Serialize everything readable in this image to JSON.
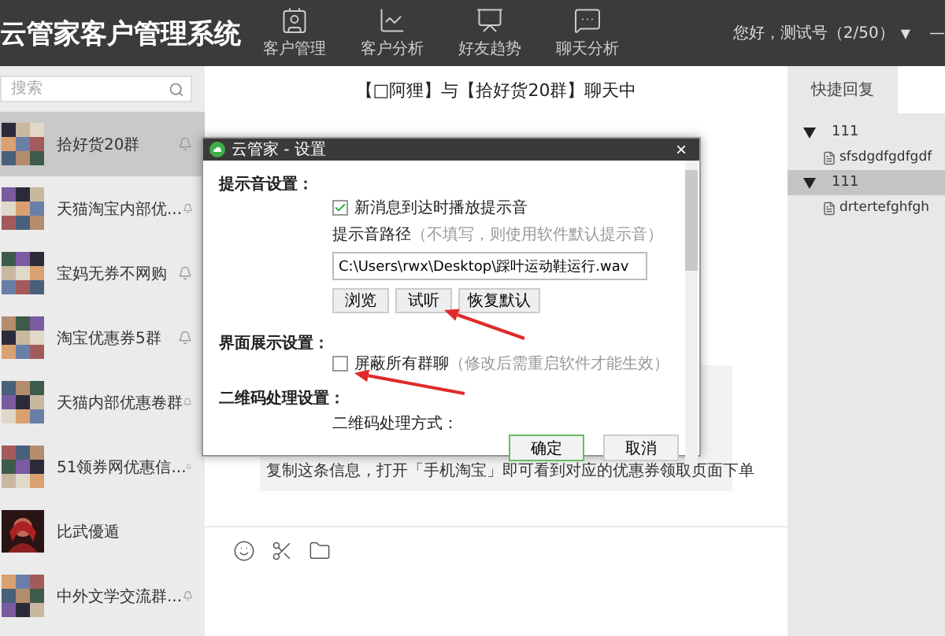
{
  "app": {
    "title": "云管家客户管理系统",
    "user": "您好，测试号（2/50）",
    "user_caret": "▼",
    "minimize": "—"
  },
  "nav": [
    {
      "label": "客户管理",
      "kind": "card"
    },
    {
      "label": "客户分析",
      "kind": "chart"
    },
    {
      "label": "好友趋势",
      "kind": "board"
    },
    {
      "label": "聊天分析",
      "kind": "chat"
    }
  ],
  "sidebar": {
    "search": {
      "placeholder": "搜索"
    },
    "items": [
      {
        "name": "拾好货20群",
        "selected": true,
        "bell": true,
        "kind": "mosaic"
      },
      {
        "name": "天猫淘宝内部优...",
        "selected": false,
        "bell": true,
        "kind": "mosaic"
      },
      {
        "name": "宝妈无券不网购",
        "selected": false,
        "bell": true,
        "kind": "mosaic"
      },
      {
        "name": "淘宝优惠券5群",
        "selected": false,
        "bell": true,
        "kind": "mosaic"
      },
      {
        "name": "天猫内部优惠卷群",
        "selected": false,
        "bell": true,
        "kind": "mosaic"
      },
      {
        "name": "51领券网优惠信...",
        "selected": false,
        "bell": true,
        "kind": "mosaic"
      },
      {
        "name": "比武優遁",
        "selected": false,
        "bell": false,
        "kind": "portrait"
      },
      {
        "name": "中外文学交流群...",
        "selected": false,
        "bell": true,
        "kind": "mosaic"
      }
    ]
  },
  "chat": {
    "title": "【□阿狸】与【拾好货20群】聊天中",
    "message": "复制这条信息，打开「手机淘宝」即可看到对应的优惠券领取页面下单"
  },
  "quick_reply": {
    "tab": "快捷回复",
    "groups": [
      {
        "label": "111",
        "expanded": true,
        "selected": false,
        "children": [
          {
            "label": "sfsdgdfgdfgdf"
          }
        ]
      },
      {
        "label": "111",
        "expanded": true,
        "selected": true,
        "children": [
          {
            "label": "drtertefghfgh"
          }
        ]
      }
    ]
  },
  "dialog": {
    "title": "云管家 - 设置",
    "close": "×",
    "sound_section": "提示音设置：",
    "play_sound": {
      "label": "新消息到达时播放提示音",
      "checked": true
    },
    "path_label": "提示音路径",
    "path_hint": "（不填写，则使用软件默认提示音）",
    "path_value": "C:\\Users\\rwx\\Desktop\\踩叶运动鞋运行.wav",
    "path_buttons": [
      "浏览",
      "试听",
      "恢复默认"
    ],
    "display_section": "界面展示设置：",
    "block_groups": {
      "label": "屏蔽所有群聊",
      "hint": "（修改后需重启软件才能生效）",
      "checked": false
    },
    "qr_section": "二维码处理设置：",
    "qr_method": "二维码处理方式：",
    "buttons": [
      {
        "label": "确定",
        "primary": true
      },
      {
        "label": "取消",
        "primary": false
      }
    ]
  }
}
